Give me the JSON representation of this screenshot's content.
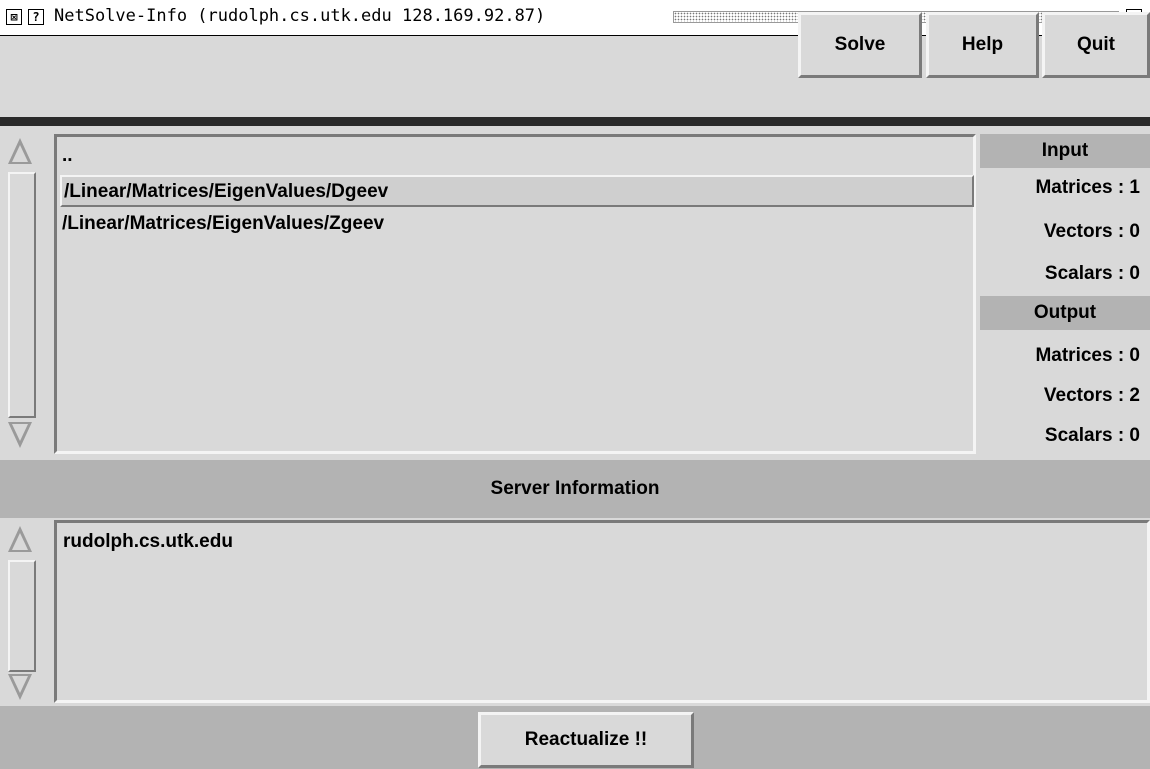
{
  "window": {
    "title": "NetSolve-Info (rudolph.cs.utk.edu 128.169.92.87)",
    "close_glyph": "⊠",
    "help_glyph": "?"
  },
  "toolbar": {
    "solve_label": "Solve",
    "help_label": "Help",
    "quit_label": "Quit"
  },
  "problems": {
    "items": [
      {
        "label": ".."
      },
      {
        "label": "/Linear/Matrices/EigenValues/Dgeev",
        "selected": true
      },
      {
        "label": "/Linear/Matrices/EigenValues/Zgeev"
      }
    ]
  },
  "info": {
    "input_header": "Input",
    "input_rows": [
      "Matrices : 1",
      "Vectors :  0",
      "Scalars :  0"
    ],
    "output_header": "Output",
    "output_rows": [
      "Matrices : 0",
      "Vectors :  2",
      "Scalars :  0"
    ]
  },
  "server": {
    "section_label": "Server Information",
    "entries": [
      "rudolph.cs.utk.edu"
    ]
  },
  "footer": {
    "reactualize_label": "Reactualize !!"
  }
}
